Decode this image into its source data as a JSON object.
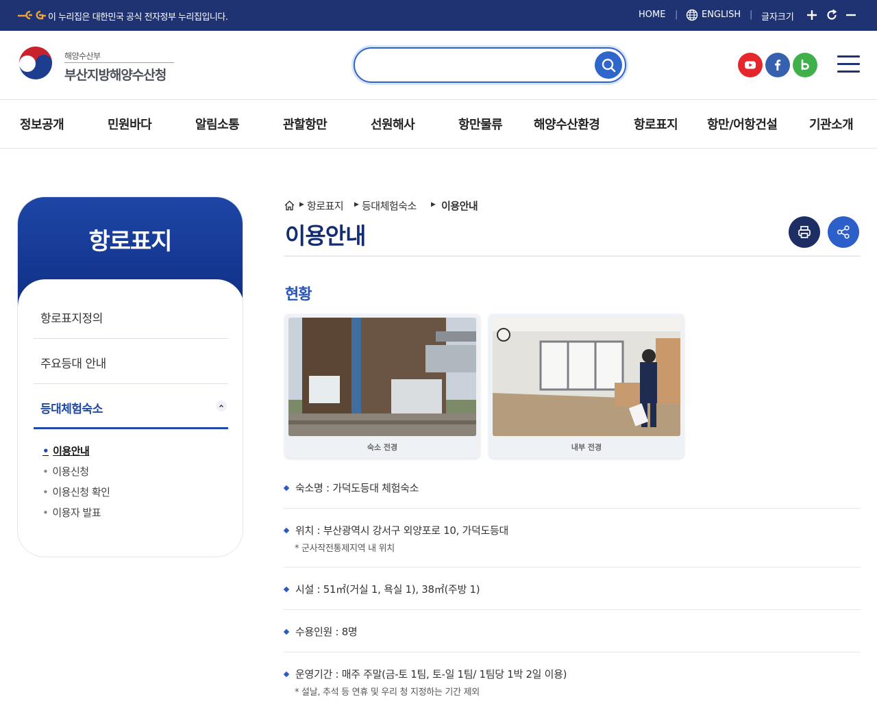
{
  "topbar": {
    "gov_notice": "이 누리집은 대한민국 공식 전자정부 누리집입니다.",
    "home": "HOME",
    "english": "ENGLISH",
    "font_size": "글자크기",
    "separator": "|"
  },
  "header": {
    "org_sub": "해양수산부",
    "org_name": "부산지방해양수산청",
    "search_placeholder": "",
    "sns": [
      "youtube-icon",
      "facebook-icon",
      "blog-icon"
    ]
  },
  "gnb": [
    "정보공개",
    "민원바다",
    "알림소통",
    "관할항만",
    "선원해사",
    "항만물류",
    "해양수산환경",
    "항로표지",
    "항만/어항건설",
    "기관소개"
  ],
  "side": {
    "title": "항로표지",
    "items": [
      "항로표지정의",
      "주요등대 안내",
      "등대체험숙소"
    ],
    "sub_items": [
      "이용안내",
      "이용신청",
      "이용신청 확인",
      "이용자 발표"
    ],
    "dot": "•"
  },
  "breadcrumb": [
    "항로표지",
    "등대체험숙소",
    "이용안내"
  ],
  "page_title": "이용안내",
  "section_title": "현황",
  "photos": [
    {
      "caption": "숙소 전경"
    },
    {
      "caption": "내부 전경"
    }
  ],
  "info": [
    {
      "main": "숙소명 : 가덕도등대 체험숙소",
      "note": ""
    },
    {
      "main": "위치 : 부산광역시 강서구 외양포로 10, 가덕도등대",
      "note": "* 군사작전통제지역 내 위치"
    },
    {
      "main": "시설 : 51㎡(거실 1, 욕실 1), 38㎡(주방 1)",
      "note": ""
    },
    {
      "main": "수용인원 : 8명",
      "note": ""
    },
    {
      "main": "운영기간 : 매주 주말(금-토 1팀, 토-일 1팀/ 1팀당 1박 2일 이용)",
      "note": "* 설날, 추석 등 연휴 및 우리 청 지정하는 기간 제외"
    }
  ],
  "colors": {
    "topbar": "#1f3372",
    "brand": "#122d74",
    "accent": "#2c5fc9"
  }
}
